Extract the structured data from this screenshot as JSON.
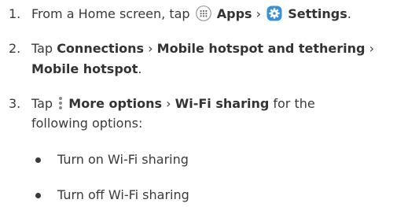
{
  "steps": [
    {
      "num": "1.",
      "pre": "From a Home screen, tap",
      "apps": "Apps",
      "sep": "›",
      "settings": "Settings",
      "end": "."
    },
    {
      "num": "2.",
      "pre": "Tap",
      "connections": "Connections",
      "sep1": "›",
      "mh_tethering": "Mobile hotspot and tethering",
      "sep2": "›",
      "mobile_hotspot": "Mobile hotspot",
      "end": "."
    },
    {
      "num": "3.",
      "pre": "Tap",
      "more_options": "More options",
      "sep": "›",
      "wifi_sharing": "Wi-Fi sharing",
      "post": "for the",
      "cont": "following options:"
    }
  ],
  "bullets": [
    "Turn on Wi-Fi sharing",
    "Turn off Wi-Fi sharing"
  ],
  "icons": {
    "apps": "apps-grid-icon",
    "settings": "settings-gear-icon",
    "more": "more-options-icon"
  },
  "colors": {
    "text": "#3a3a3a",
    "settings_icon_bg": "#3b8fd6"
  }
}
